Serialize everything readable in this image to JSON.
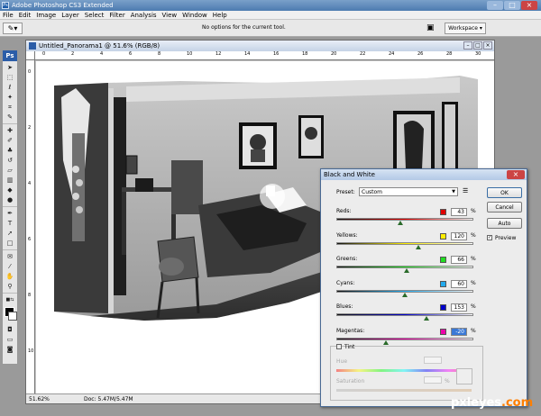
{
  "app": {
    "title": "Adobe Photoshop CS3 Extended",
    "icon_label": "Ps"
  },
  "menu": [
    "File",
    "Edit",
    "Image",
    "Layer",
    "Select",
    "Filter",
    "Analysis",
    "View",
    "Window",
    "Help"
  ],
  "options_bar": {
    "message": "No options for the current tool.",
    "workspace_label": "Workspace ▾"
  },
  "document": {
    "title": "Untitled_Panorama1 @ 51.6% (RGB/8)",
    "zoom": "51.62%",
    "doc_size": "Doc: 5.47M/5.47M",
    "ruler_h": [
      "0",
      "2",
      "4",
      "6",
      "8",
      "10",
      "12",
      "14",
      "16",
      "18",
      "20",
      "22",
      "24",
      "26",
      "28",
      "30"
    ],
    "ruler_v": [
      "0",
      "2",
      "4",
      "6",
      "8",
      "10"
    ]
  },
  "dialog": {
    "title": "Black and White",
    "preset_label": "Preset:",
    "preset_value": "Custom",
    "buttons": {
      "ok": "OK",
      "cancel": "Cancel",
      "auto": "Auto"
    },
    "preview_label": "Preview",
    "preview_checked": true,
    "sliders": [
      {
        "label": "Reds:",
        "value": "43",
        "color": "#e00000",
        "level": 0.47
      },
      {
        "label": "Yellows:",
        "value": "120",
        "color": "#ffee00",
        "level": 0.6
      },
      {
        "label": "Greens:",
        "value": "66",
        "color": "#22dd22",
        "level": 0.51
      },
      {
        "label": "Cyans:",
        "value": "60",
        "color": "#22aaee",
        "level": 0.5
      },
      {
        "label": "Blues:",
        "value": "153",
        "color": "#0000cc",
        "level": 0.66
      },
      {
        "label": "Magentas:",
        "value": "-20",
        "color": "#ee00aa",
        "level": 0.36,
        "selected": true
      }
    ],
    "percent": "%",
    "tint_label": "Tint",
    "hue_label": "Hue",
    "saturation_label": "Saturation"
  },
  "watermark": {
    "main": "pxleyes",
    "suffix": ".com"
  },
  "colors": {
    "accent": "#3a78d6",
    "title_bar": "#4d7bb0",
    "workspace_bg": "#9a9a9a"
  }
}
